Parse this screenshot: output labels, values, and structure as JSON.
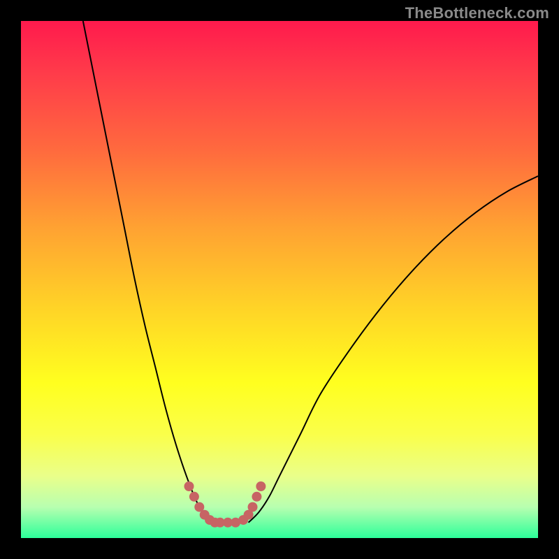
{
  "watermark": "TheBottleneck.com",
  "colors": {
    "frame_bg": "#000000",
    "gradient_top": "#ff1a4d",
    "gradient_bottom": "#2cff9a",
    "curve": "#000000",
    "dots": "#c76464"
  },
  "chart_data": {
    "type": "line",
    "title": "",
    "xlabel": "",
    "ylabel": "",
    "xlim": [
      0,
      100
    ],
    "ylim": [
      0,
      100
    ],
    "series": [
      {
        "name": "left-curve",
        "x": [
          12,
          14,
          16,
          18,
          20,
          22,
          24,
          26,
          28,
          30,
          32,
          34,
          36,
          38
        ],
        "y": [
          100,
          90,
          80,
          70,
          60,
          50,
          41,
          33,
          25,
          18,
          12,
          7,
          4,
          3
        ]
      },
      {
        "name": "right-curve",
        "x": [
          44,
          46,
          48,
          50,
          54,
          58,
          64,
          70,
          76,
          82,
          88,
          94,
          100
        ],
        "y": [
          3,
          5,
          8,
          12,
          20,
          28,
          37,
          45,
          52,
          58,
          63,
          67,
          70
        ]
      }
    ],
    "highlight_points": {
      "x": [
        32.5,
        33.5,
        34.5,
        35.5,
        36.5,
        37.5,
        38.5,
        40.0,
        41.5,
        43.0,
        44.0,
        44.8,
        45.6,
        46.4
      ],
      "y": [
        10.0,
        8.0,
        6.0,
        4.5,
        3.5,
        3.0,
        3.0,
        3.0,
        3.0,
        3.5,
        4.5,
        6.0,
        8.0,
        10.0
      ]
    }
  }
}
